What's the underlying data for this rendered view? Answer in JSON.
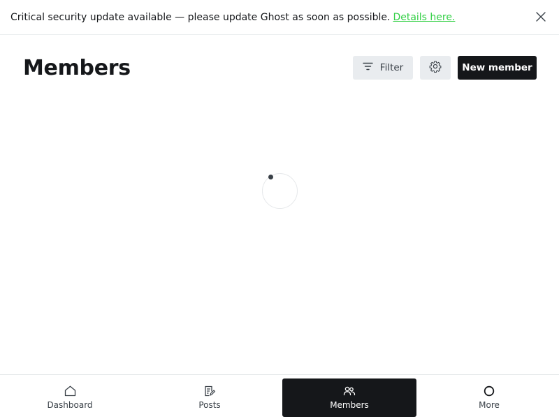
{
  "banner": {
    "message": "Critical security update available — please update Ghost as soon as possible.",
    "link_label": "Details here.",
    "link_color": "#30cf43",
    "close_icon": "close-icon"
  },
  "header": {
    "title": "Members",
    "filter_label": "Filter",
    "filter_icon": "filter-icon",
    "settings_icon": "gear-icon",
    "new_member_label": "New member"
  },
  "main": {
    "state": "loading",
    "spinner_icon": "loading-spinner"
  },
  "bottom_nav": {
    "items": [
      {
        "label": "Dashboard",
        "icon": "home-icon",
        "active": false
      },
      {
        "label": "Posts",
        "icon": "posts-icon",
        "active": false
      },
      {
        "label": "Members",
        "icon": "members-icon",
        "active": true
      },
      {
        "label": "More",
        "icon": "circle-icon",
        "active": false
      }
    ],
    "active_color": "#15171a"
  }
}
